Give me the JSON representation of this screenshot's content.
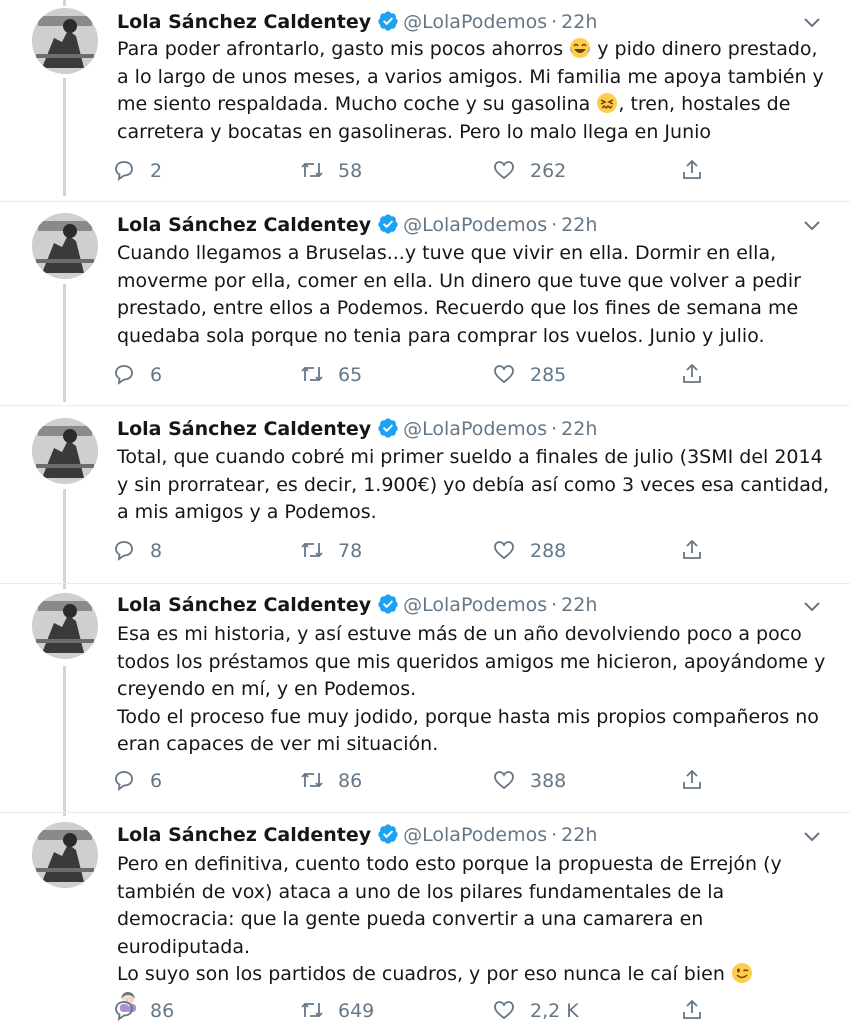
{
  "author": {
    "name": "Lola Sánchez Caldentey",
    "handle": "@LolaPodemos",
    "separator": "·",
    "time": "22h"
  },
  "colors": {
    "verified": "#1da1f2",
    "text": "#14171a",
    "muted": "#657786",
    "line": "#ccd6dd"
  },
  "icons": [
    "reply-icon",
    "retweet-icon",
    "like-icon",
    "share-icon",
    "verified-badge-icon",
    "chevron-down-icon"
  ],
  "tweets": [
    {
      "lines": [
        "Para poder afrontarlo, gasto mis pocos ahorros",
        " y pido dinero prestado, a lo largo de unos meses, a varios amigos. Mi familia me apoya también y me siento respaldada. Mucho coche y su gasolina",
        ", tren, hostales de carretera y bocatas en gasolineras. Pero lo malo llega en Junio"
      ],
      "replies": "2",
      "retweets": "58",
      "likes": "262"
    },
    {
      "text": "Cuando llegamos a Bruselas...y tuve que vivir en ella. Dormir en ella, moverme por ella, comer en ella. Un dinero que tuve que volver a pedir prestado, entre ellos a Podemos. Recuerdo que los fines de semana me quedaba sola porque no tenia para comprar los vuelos. Junio y julio.",
      "replies": "6",
      "retweets": "65",
      "likes": "285"
    },
    {
      "text": "Total, que cuando cobré mi primer sueldo a finales de julio (3SMI del 2014 y sin prorratear, es decir, 1.900€) yo debía así como 3 veces esa cantidad, a mis amigos y a Podemos.",
      "replies": "8",
      "retweets": "78",
      "likes": "288"
    },
    {
      "text": "Esa es mi historia, y así estuve más de un año devolviendo poco a poco todos los préstamos que mis queridos amigos me hicieron, apoyándome y creyendo en mí, y en Podemos.\nTodo el proceso fue muy jodido, porque hasta mis propios compañeros no eran capaces de ver mi situación.",
      "replies": "6",
      "retweets": "86",
      "likes": "388"
    },
    {
      "text1": "Pero en definitiva, cuento todo esto porque la propuesta de Errejón (y también de vox) ataca a uno de los pilares fundamentales de la democracia: que la gente pueda convertir a una camarera en eurodiputada.\nLo suyo son los partidos de cuadros, y por eso nunca le caí bien ",
      "replies": "86",
      "retweets": "649",
      "likes": "2,2 K"
    }
  ]
}
